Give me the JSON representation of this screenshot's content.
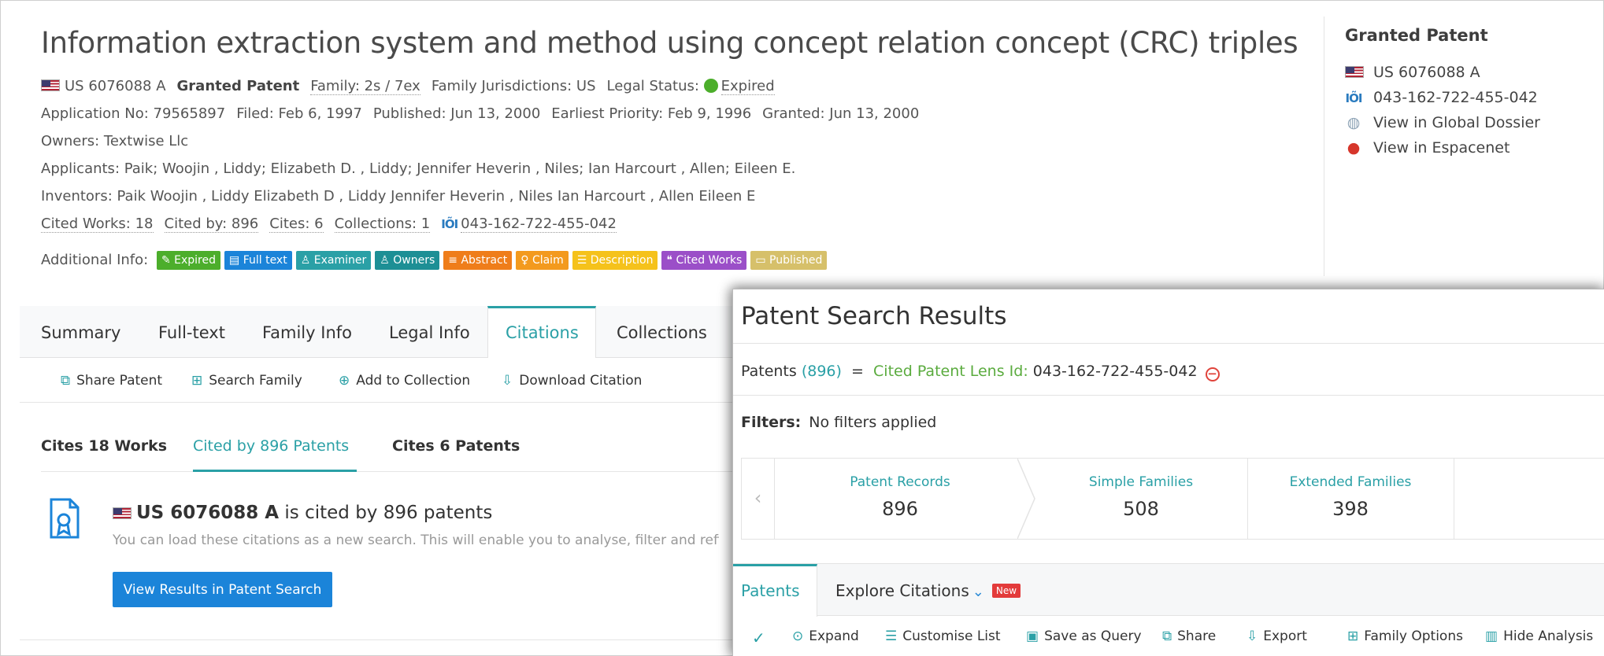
{
  "patent": {
    "title": "Information extraction system and method using concept relation concept (CRC) triples",
    "number": "US 6076088 A",
    "granted_label": "Granted Patent",
    "family": "Family: 2s / 7ex",
    "family_jurisdictions": "Family Jurisdictions: US",
    "legal_status_label": "Legal Status:",
    "legal_status_value": "Expired",
    "application_no": "Application No: 79565897",
    "filed": "Filed: Feb 6, 1997",
    "published": "Published: Jun 13, 2000",
    "earliest_priority": "Earliest Priority: Feb 9, 1996",
    "granted": "Granted: Jun 13, 2000",
    "owners": "Owners: Textwise Llc",
    "applicants": "Applicants: Paik; Woojin , Liddy; Elizabeth D. , Liddy; Jennifer Heverin , Niles; Ian Harcourt , Allen; Eileen E.",
    "inventors": "Inventors: Paik Woojin , Liddy Elizabeth D , Liddy Jennifer Heverin , Niles Ian Harcourt , Allen Eileen E",
    "cited_works": "Cited Works: 18",
    "cited_by": "Cited by: 896",
    "cites": "Cites: 6",
    "collections": "Collections: 1",
    "lens_id": "043-162-722-455-042",
    "additional_info_label": "Additional Info:",
    "badges": [
      {
        "label": "Expired",
        "color": "#4cae2b",
        "icon": "✎"
      },
      {
        "label": "Full text",
        "color": "#1b84d9",
        "icon": "▤"
      },
      {
        "label": "Examiner",
        "color": "#2aa0a6",
        "icon": "👤"
      },
      {
        "label": "Owners",
        "color": "#1d8f95",
        "icon": "👥"
      },
      {
        "label": "Abstract",
        "color": "#ef7d1a",
        "icon": "≡"
      },
      {
        "label": "Claim",
        "color": "#f39a1e",
        "icon": "⚲"
      },
      {
        "label": "Description",
        "color": "#f5c21b",
        "icon": "☰"
      },
      {
        "label": "Cited Works",
        "color": "#9b4fc8",
        "icon": "❝"
      },
      {
        "label": "Published",
        "color": "#d6c06a",
        "icon": "▭"
      }
    ]
  },
  "side": {
    "title": "Granted Patent",
    "number": "US 6076088 A",
    "lens_id": "043-162-722-455-042",
    "global_dossier": "View in Global Dossier",
    "espacenet": "View in Espacenet"
  },
  "tabs": [
    "Summary",
    "Full-text",
    "Family Info",
    "Legal Info",
    "Citations",
    "Collections"
  ],
  "toolbar": {
    "share": "Share Patent",
    "search_family": "Search Family",
    "add_collection": "Add to Collection",
    "download": "Download Citation"
  },
  "subtabs": {
    "cites_works": "Cites 18 Works",
    "cited_by": "Cited by 896 Patents",
    "cites_patents": "Cites 6 Patents"
  },
  "citation_box": {
    "number": "US 6076088 A",
    "text": " is cited by 896 patents",
    "sub": "You can load these citations as a new search. This will enable you to analyse, filter and refine",
    "button": "View Results in Patent Search"
  },
  "overlay": {
    "title": "Patent Search Results",
    "query_patents": "Patents",
    "query_count": "(896)",
    "query_eq": "=",
    "query_field": "Cited Patent Lens Id:",
    "query_value": "043-162-722-455-042",
    "filters_label": "Filters:",
    "filters_value": "No filters applied",
    "stats": [
      {
        "label": "Patent Records",
        "value": "896"
      },
      {
        "label": "Simple Families",
        "value": "508"
      },
      {
        "label": "Extended Families",
        "value": "398"
      }
    ],
    "tab_patents": "Patents",
    "tab_explore": "Explore Citations",
    "new_badge": "New",
    "tools": {
      "expand": "Expand",
      "customise": "Customise List",
      "save_query": "Save as Query",
      "share": "Share",
      "export": "Export",
      "family_options": "Family Options",
      "hide_analysis": "Hide Analysis"
    }
  }
}
